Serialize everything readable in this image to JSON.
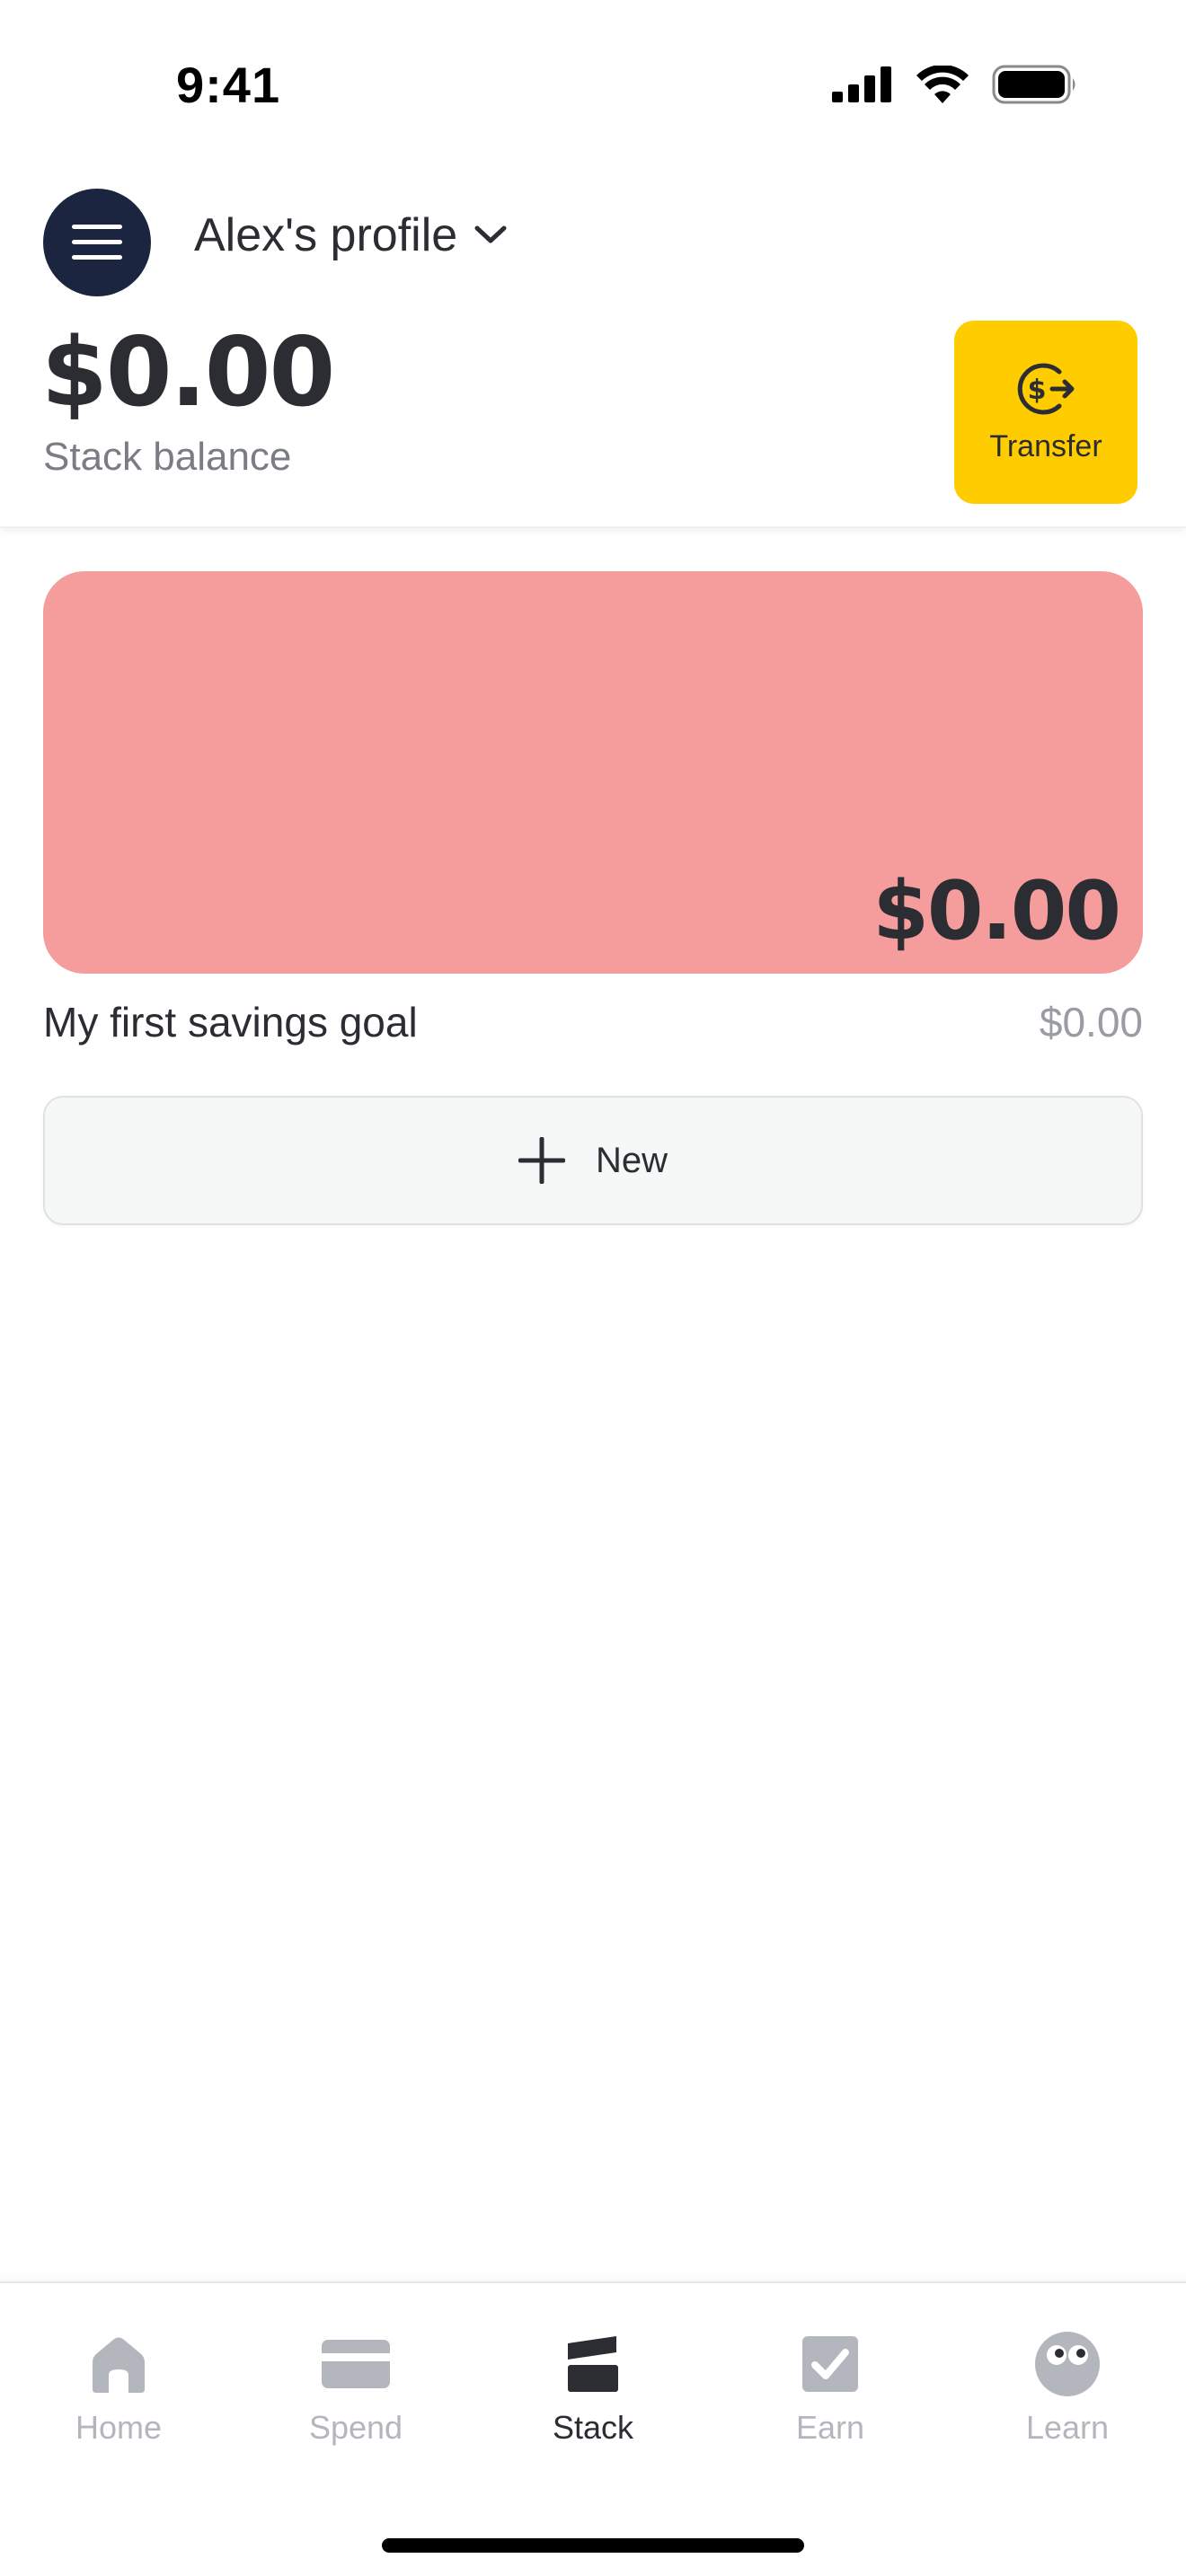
{
  "status_bar": {
    "time": "9:41"
  },
  "header": {
    "profile_name": "Alex's profile",
    "balance": "$0.00",
    "balance_label": "Stack balance",
    "transfer_label": "Transfer"
  },
  "goals": [
    {
      "card_amount": "$0.00",
      "name": "My first savings goal",
      "amount": "$0.00",
      "color": "#f49d9c"
    }
  ],
  "new_button": {
    "label": "New"
  },
  "tab_bar": {
    "active": "Stack",
    "items": [
      {
        "label": "Home",
        "icon": "home-icon"
      },
      {
        "label": "Spend",
        "icon": "card-icon"
      },
      {
        "label": "Stack",
        "icon": "stack-icon"
      },
      {
        "label": "Earn",
        "icon": "checkbox-icon"
      },
      {
        "label": "Learn",
        "icon": "eyes-icon"
      }
    ]
  },
  "colors": {
    "accent": "#ffcc00",
    "menu_button": "#1b2540",
    "text": "#2b2d33",
    "inactive": "#b4b6bd"
  }
}
